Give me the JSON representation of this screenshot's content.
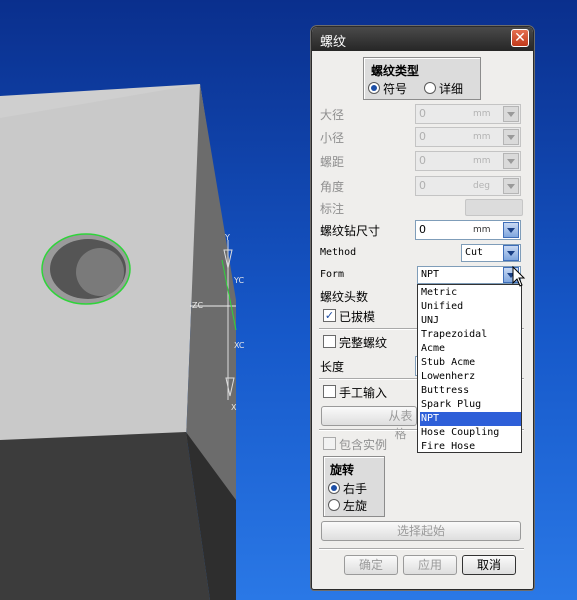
{
  "dialog": {
    "title": "螺纹",
    "close": "✕",
    "thread_type": {
      "title": "螺纹类型",
      "opt_symbol": "符号",
      "opt_detail": "详细"
    },
    "major_diameter": {
      "label": "大径",
      "value": "0",
      "unit": "mm"
    },
    "minor_diameter": {
      "label": "小径",
      "value": "0",
      "unit": "mm"
    },
    "pitch": {
      "label": "螺距",
      "value": "0",
      "unit": "mm"
    },
    "angle": {
      "label": "角度",
      "value": "0",
      "unit": "deg"
    },
    "callout": {
      "label": "标注",
      "value": ""
    },
    "tap_drill": {
      "label": "螺纹钻尺寸",
      "value": "0",
      "unit": "mm"
    },
    "method": {
      "label": "Method",
      "value": "Cut"
    },
    "form": {
      "label": "Form",
      "value": "NPT"
    },
    "num_starts": {
      "label": "螺纹头数"
    },
    "tapered": {
      "label": "已拔模",
      "checked": true
    },
    "full_thread": {
      "label": "完整螺纹",
      "checked": false
    },
    "length": {
      "label": "长度"
    },
    "manual_input": {
      "label": "手工输入",
      "checked": false
    },
    "from_table": {
      "label": "从表格"
    },
    "include_instances": {
      "label": "包含实例",
      "checked": false
    },
    "rotation": {
      "title": "旋转",
      "opt_right": "右手",
      "opt_left": "左旋"
    },
    "select_start": {
      "label": "选择起始"
    },
    "buttons": {
      "ok": "确定",
      "apply": "应用",
      "cancel": "取消"
    }
  },
  "form_dropdown": {
    "options": [
      "Metric",
      "Unified",
      "UNJ",
      "Trapezoidal",
      "Acme",
      "Stub Acme",
      "Lowenherz",
      "Buttress",
      "Spark Plug",
      "NPT",
      "Hose Coupling",
      "Fire Hose"
    ],
    "selected": "NPT"
  },
  "viewport": {
    "axis_labels": {
      "y": "Y",
      "yc": "YC",
      "x": "X",
      "xc": "XC",
      "zc": "ZC"
    }
  },
  "colors": {
    "viewport_top": "#0a2f8d",
    "viewport_bottom": "#2a78e6",
    "selection": "#2e5fd8",
    "hole_edge": "#2fd43a"
  }
}
